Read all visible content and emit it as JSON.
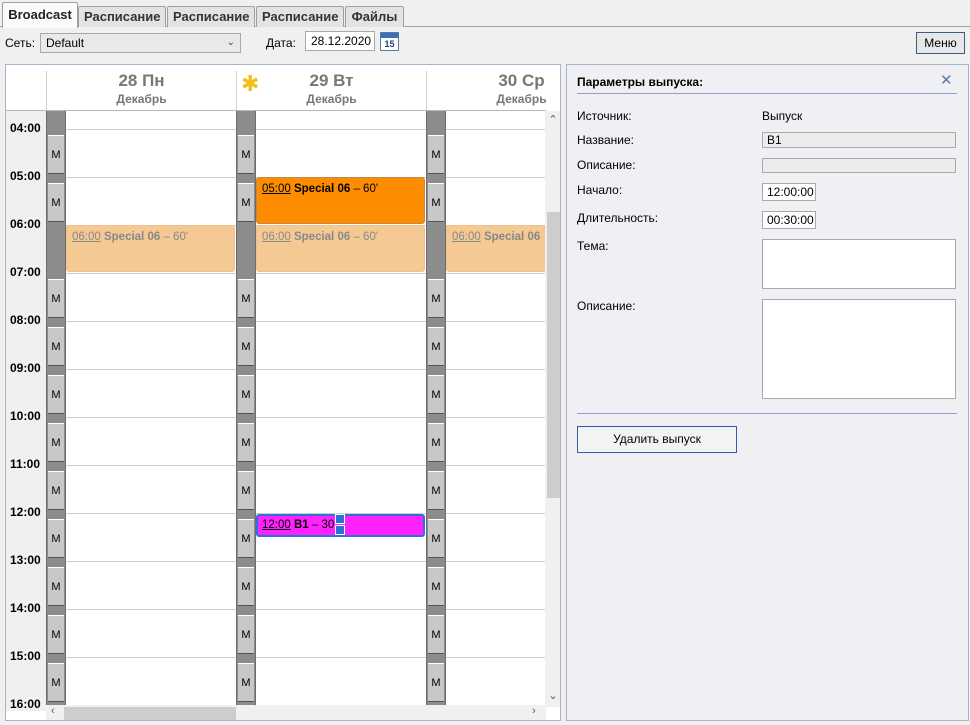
{
  "tabs": [
    {
      "label": "Broadcast",
      "active": true
    },
    {
      "label": "Расписание",
      "active": false
    },
    {
      "label": "Расписание",
      "active": false
    },
    {
      "label": "Расписание",
      "active": false
    },
    {
      "label": "Файлы",
      "active": false
    }
  ],
  "toolbar": {
    "network_label": "Сеть:",
    "network_value": "Default",
    "date_label": "Дата:",
    "date_value": "28.12.2020",
    "calendar_icon_day": "15",
    "menu_label": "Меню"
  },
  "schedule": {
    "days": [
      {
        "num": "28 Пн",
        "month": "Декабрь"
      },
      {
        "num": "29 Вт",
        "month": "Декабрь"
      },
      {
        "num": "30 Ср",
        "month": "Декабрь"
      }
    ],
    "times": [
      "04:00",
      "05:00",
      "06:00",
      "07:00",
      "08:00",
      "09:00",
      "10:00",
      "11:00",
      "12:00",
      "13:00",
      "14:00",
      "15:00",
      "16:00"
    ],
    "marker": "M",
    "events": {
      "ev_mon_0600": {
        "time": "06:00",
        "title": "Special 06",
        "dur": "– 60'"
      },
      "ev_tue_0500": {
        "time": "05:00",
        "title": "Special 06",
        "dur": "– 60'"
      },
      "ev_tue_0600": {
        "time": "06:00",
        "title": "Special 06",
        "dur": "– 60'"
      },
      "ev_wed_0600": {
        "time": "06:00",
        "title": "Special 06",
        "dur": ""
      },
      "ev_tue_1200": {
        "time": "12:00",
        "title": "B1",
        "dur": "– 30"
      }
    },
    "colors": {
      "selected": "#ff22ff",
      "active": "#fd8c00",
      "ghost": "#f5c993"
    }
  },
  "properties": {
    "title": "Параметры выпуска:",
    "source_label": "Источник:",
    "source_value": "Выпуск",
    "name_label": "Название:",
    "name_value": "B1",
    "desc_label": "Описание:",
    "desc_value": "",
    "start_label": "Начало:",
    "start_value": "12:00:00",
    "duration_label": "Длительность:",
    "duration_value": "00:30:00",
    "topic_label": "Тема:",
    "topic_value": "",
    "description_label": "Описание:",
    "description_value": "",
    "delete_button": "Удалить выпуск"
  }
}
